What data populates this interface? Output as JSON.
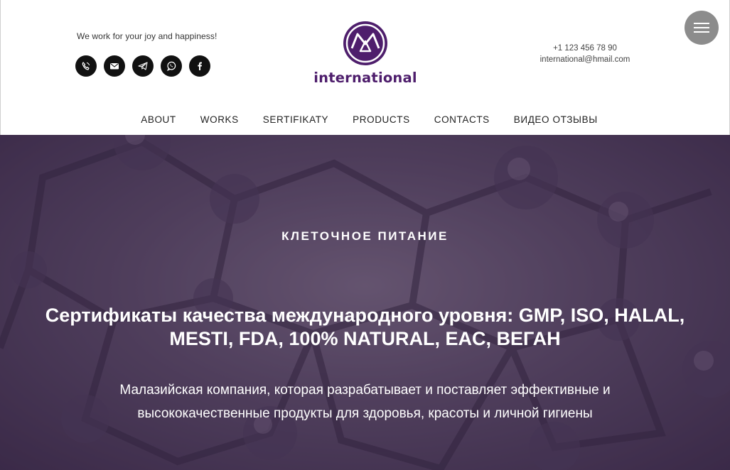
{
  "header": {
    "tagline": "We work for your joy and happiness!",
    "logo_text": "international",
    "phone": "+1 123 456 78 90",
    "email": "international@hmail.com"
  },
  "socials": [
    {
      "icon": "viber-icon"
    },
    {
      "icon": "mail-icon"
    },
    {
      "icon": "telegram-icon"
    },
    {
      "icon": "whatsapp-icon"
    },
    {
      "icon": "facebook-icon"
    }
  ],
  "nav": {
    "items": [
      "ABOUT",
      "WORKS",
      "SERTIFIKATY",
      "PRODUCTS",
      "CONTACTS",
      "ВИДЕО ОТЗЫВЫ"
    ]
  },
  "hero": {
    "kicker": "КЛЕТОЧНОЕ ПИТАНИЕ",
    "title": "Сертификаты качества международного уровня: GMP, ISO, HALAL, MESTI, FDA, 100% NATURAL, EAC, ВЕГАН",
    "description": "Малазийская компания, которая разрабатывает и поставляет эффективные и высококачественные продукты для здоровья, красоты и личной гигиены"
  },
  "colors": {
    "brand": "#4e1e6c",
    "hero_bg": "#5a4b63",
    "menu_button": "#8c8c8c"
  }
}
